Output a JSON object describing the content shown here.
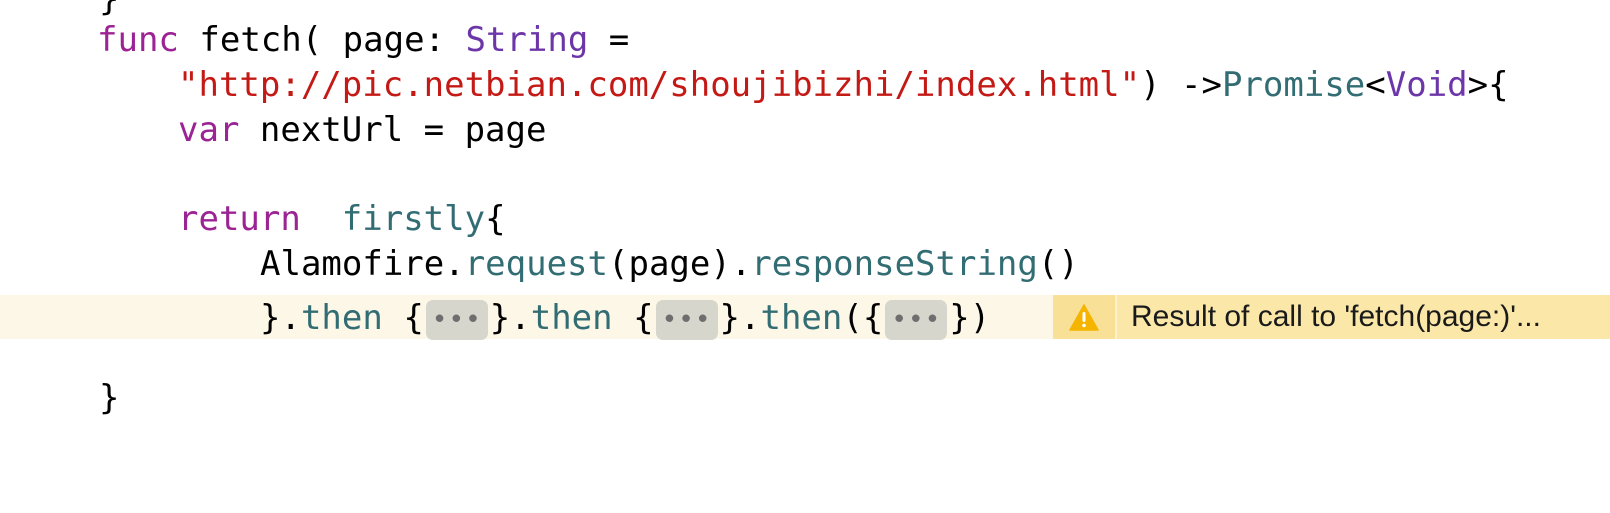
{
  "editor": {
    "brace_top": "}",
    "line1": {
      "kw_func": "func",
      "name": "fetch( page: ",
      "type": "String",
      "eq": " ="
    },
    "line2": {
      "url": "\"http://pic.netbian.com/shoujibizhi/index.html\"",
      "paren": ") ->",
      "promise": "Promise",
      "lt": "<",
      "void": "Void",
      "gt": ">{"
    },
    "line3": {
      "kw_var": "var",
      "rest": " nextUrl = page"
    },
    "line4": {
      "kw_return": "return",
      "space": "  ",
      "firstly": "firstly",
      "brace": "{"
    },
    "line5": {
      "alamofire": "Alamofire.",
      "request": "request",
      "page": "(page).",
      "response": "responseString",
      "parens": "()"
    },
    "line6": {
      "close": "}.",
      "then1": "then",
      "open1": " {",
      "fold": "•••",
      "close1": "}.",
      "then2": "then",
      "open2": " {",
      "close2": "}.",
      "then3": "then",
      "open3": "({",
      "close3": "})"
    },
    "brace_bottom": "}"
  },
  "warning": {
    "icon": "warning-triangle-icon",
    "message": "Result of call to 'fetch(page:)'..."
  },
  "colors": {
    "keyword": "#9b2393",
    "type": "#6c36a9",
    "string": "#c41a16",
    "function": "#326d74",
    "warning_bar": "#fbe7a8",
    "line_highlight": "#fdf7e7"
  }
}
